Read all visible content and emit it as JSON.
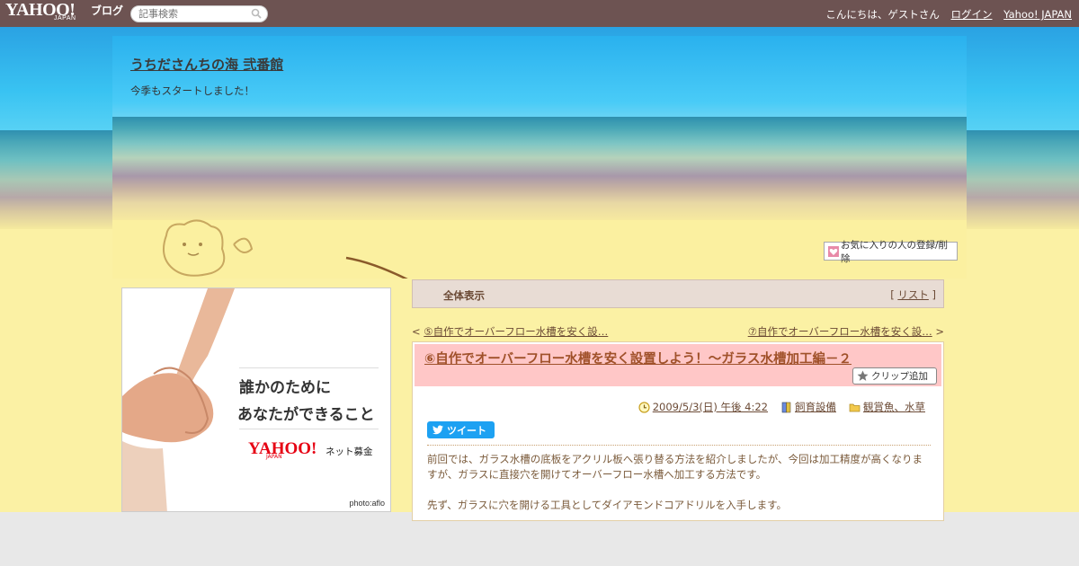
{
  "topbar": {
    "logo": "YAHOO!",
    "logo_sub": "JAPAN",
    "logo_blog": "ブログ",
    "search_placeholder": "記事検索",
    "greeting": "こんにちは、ゲストさん",
    "login_label": "ログイン",
    "yahoo_japan_label": "Yahoo! JAPAN"
  },
  "header": {
    "blog_title": "うちださんちの海 弐番館",
    "blog_description": "今季もスタートしました！",
    "fav_button_label": "お気に入りの人の登録/削除"
  },
  "ad": {
    "line1": "誰かのために",
    "line2": "あなたができること",
    "logo": "YAHOO!",
    "logo_sub": "JAPAN",
    "service": "ネット募金",
    "credit": "photo:aflo"
  },
  "listbar": {
    "title": "全体表示",
    "list_label": "リスト"
  },
  "nav": {
    "prev_label": "⑤自作でオーバーフロー水槽を安く設…",
    "next_label": "⑦自作でオーバーフロー水槽を安く設…"
  },
  "article": {
    "title": "⑥自作でオーバーフロー水槽を安く設置しよう！～ガラス水槽加工編－２",
    "clip_label": "クリップ追加",
    "date": "2009/5/3(日) 午後 4:22",
    "category": "飼育設備",
    "folder": "観賞魚、水草",
    "tweet_label": "ツイート",
    "paragraphs": [
      "前回では、ガラス水槽の底板をアクリル板へ張り替る方法を紹介しましたが、今回は加工精度が高くなりますが、ガラスに直接穴を開けてオーバーフロー水槽へ加工する方法です。",
      "先ず、ガラスに穴を開ける工具としてダイアモンドコアドリルを入手します。"
    ]
  },
  "colors": {
    "topbar": "#6d5352",
    "link": "#6b4a35",
    "title_bg": "#ffc7c7",
    "tweet": "#1da1f2"
  }
}
